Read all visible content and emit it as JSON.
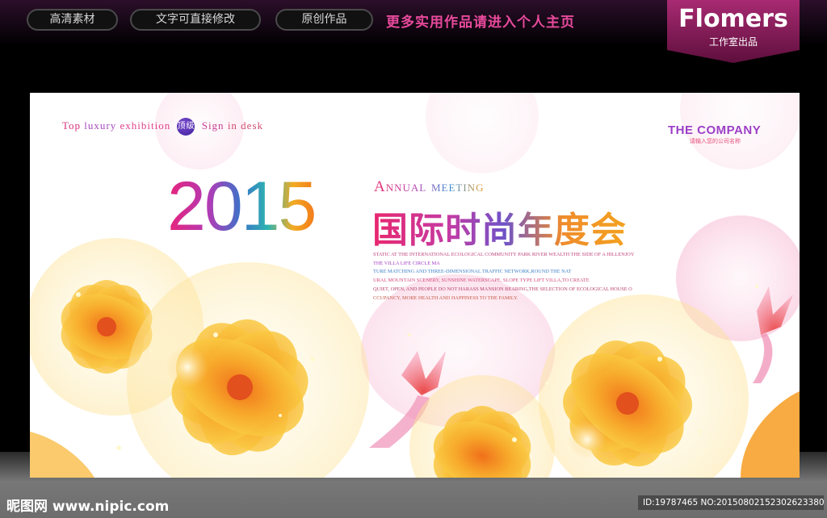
{
  "header": {
    "pills": [
      "高清素材",
      "文字可直接修改",
      "原创作品"
    ],
    "more_text": "更多实用作品请进入个人主页",
    "brand_name": "Flomers",
    "brand_sub": "工作室出品"
  },
  "poster": {
    "tagline": {
      "w1": "Top",
      "w2": "luxury",
      "w3": "exhibition",
      "badge": "顶级",
      "w4": "Sign",
      "w5": "in desk"
    },
    "company_name": "THE COMPANY",
    "company_sub": "请输入您的公司名称",
    "year": "2015",
    "annual": "Annual meeting",
    "title_cn": "国际时尚年度会",
    "description_lines": [
      "STATIC AT THE INTERNATIONAL ECOLOGICAL COMMUNITY PARK RIVER WEALTH THE SIDE OF A HILLENJOY",
      "THE VILLA LIFE CIRCLE MA",
      "TURE MATCHING AND THREE-DIMENSIONAL TRAFFIC NETWORK,ROUND THE NAT",
      "URAL MOUNTAIN SCENERY, SUNSHINE WATERSCAPE, SLOPE TYPE LIFT VILLA,TO CREATE",
      "QUIET, OPEN, AND PEOPLE DO NOT HARASS MANSION BEARING,THE SELECTION OF ECOLOGICAL HOUSE O",
      "CCUPANCY, MORE HEALTH AND HAPPINESS TO THE FAMILY."
    ]
  },
  "footer": {
    "site": "昵图网 www.nipic.com",
    "id_text": "ID:19787465 NO:20150802152302623380"
  },
  "colors": {
    "pill_text": "#d9d9d9",
    "more_text": "#e84a9c",
    "brand_bg": "#8a1a5a"
  }
}
